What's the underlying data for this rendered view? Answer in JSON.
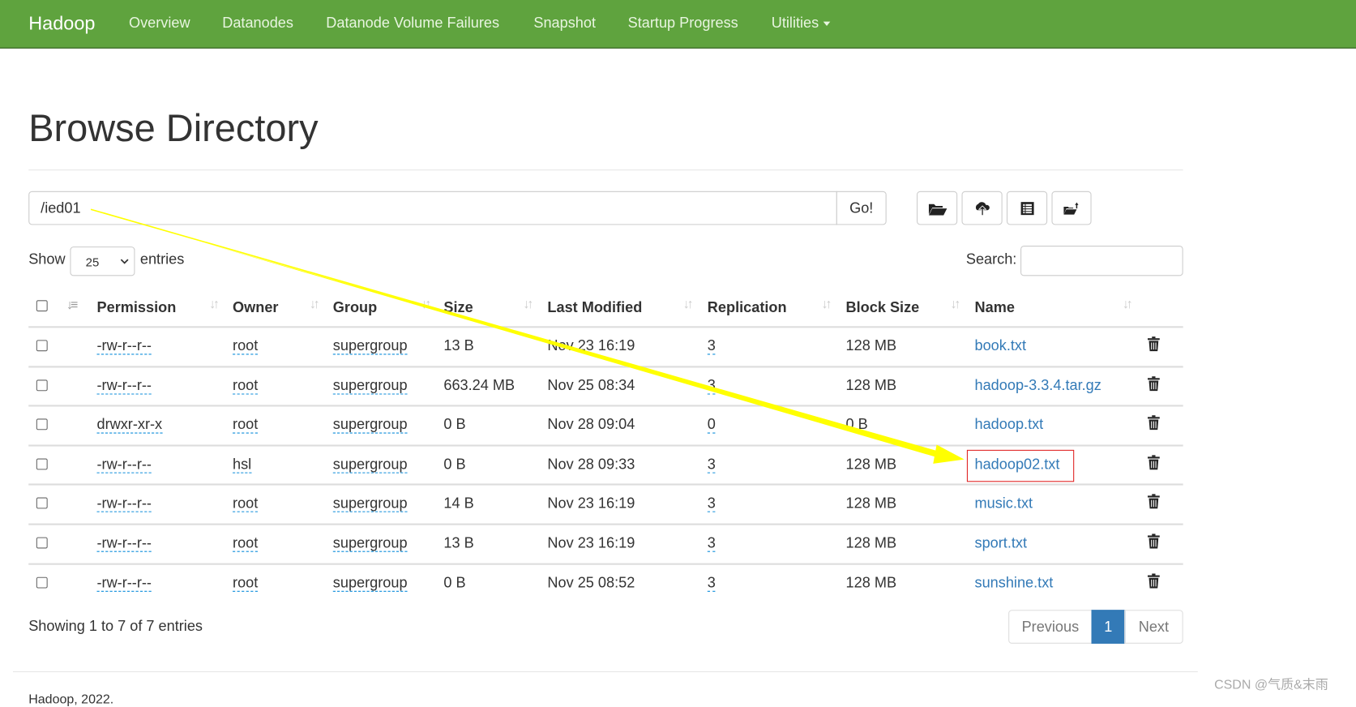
{
  "navbar": {
    "brand": "Hadoop",
    "items": [
      "Overview",
      "Datanodes",
      "Datanode Volume Failures",
      "Snapshot",
      "Startup Progress",
      "Utilities"
    ],
    "color": "#5fa33e"
  },
  "page_title": "Browse Directory",
  "path_input": {
    "value": "/ied01",
    "go_label": "Go!"
  },
  "toolbar_icons": [
    "folder-open-icon",
    "cloud-upload-icon",
    "list-alt-icon",
    "folder-upload-icon"
  ],
  "show_entries": {
    "show_label": "Show",
    "value": "25",
    "entries_label": "entries"
  },
  "search": {
    "label": "Search:",
    "value": ""
  },
  "table": {
    "columns": [
      "Permission",
      "Owner",
      "Group",
      "Size",
      "Last Modified",
      "Replication",
      "Block Size",
      "Name"
    ],
    "rows": [
      [
        "-rw-r--r--",
        "root",
        "supergroup",
        "13 B",
        "Nov 23 16:19",
        "3",
        "128 MB",
        "book.txt"
      ],
      [
        "-rw-r--r--",
        "root",
        "supergroup",
        "663.24 MB",
        "Nov 25 08:34",
        "3",
        "128 MB",
        "hadoop-3.3.4.tar.gz"
      ],
      [
        "drwxr-xr-x",
        "root",
        "supergroup",
        "0 B",
        "Nov 28 09:04",
        "0",
        "0 B",
        "hadoop.txt"
      ],
      [
        "-rw-r--r--",
        "hsl",
        "supergroup",
        "0 B",
        "Nov 28 09:33",
        "3",
        "128 MB",
        "hadoop02.txt"
      ],
      [
        "-rw-r--r--",
        "root",
        "supergroup",
        "14 B",
        "Nov 23 16:19",
        "3",
        "128 MB",
        "music.txt"
      ],
      [
        "-rw-r--r--",
        "root",
        "supergroup",
        "13 B",
        "Nov 23 16:19",
        "3",
        "128 MB",
        "sport.txt"
      ],
      [
        "-rw-r--r--",
        "root",
        "supergroup",
        "0 B",
        "Nov 25 08:52",
        "3",
        "128 MB",
        "sunshine.txt"
      ]
    ]
  },
  "info": "Showing 1 to 7 of 7 entries",
  "pagination": {
    "previous": "Previous",
    "current": "1",
    "next": "Next",
    "active_color": "#337ab7"
  },
  "footer": "Hadoop, 2022.",
  "watermark": "CSDN @气质&末雨",
  "annotation": {
    "arrow_color": "#ffff00",
    "highlight_color": "#e02020"
  }
}
